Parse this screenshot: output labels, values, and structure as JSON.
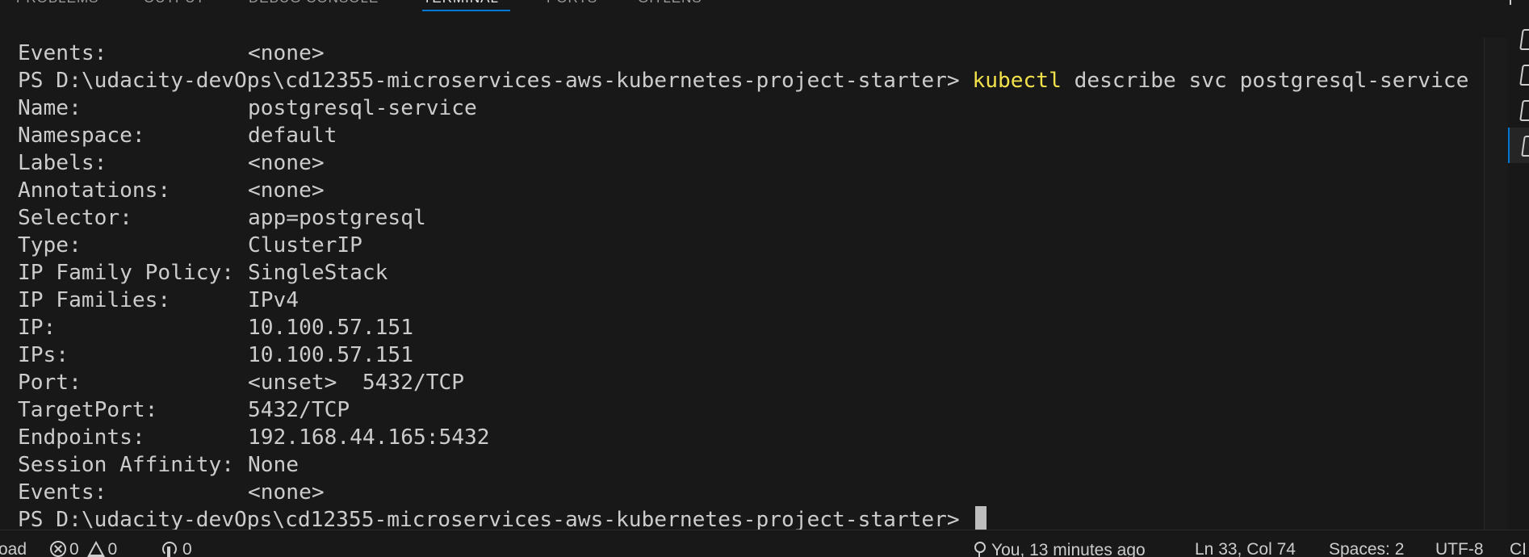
{
  "panel": {
    "tabs": [
      {
        "label": "PROBLEMS"
      },
      {
        "label": "OUTPUT"
      },
      {
        "label": "DEBUG CONSOLE"
      },
      {
        "label": "TERMINAL",
        "active": true
      },
      {
        "label": "PORTS"
      },
      {
        "label": "GITLENS"
      }
    ],
    "accent_color": "#0078d4"
  },
  "terminal": {
    "prompt": "PS D:\\udacity-devOps\\cd12355-microservices-aws-kubernetes-project-starter> ",
    "prev_events": {
      "label": "Events:",
      "value": "<none>"
    },
    "command": {
      "keyword": "kubectl",
      "args": " describe svc postgresql-service"
    },
    "fields": [
      {
        "label": "Name:",
        "value": "postgresql-service"
      },
      {
        "label": "Namespace:",
        "value": "default"
      },
      {
        "label": "Labels:",
        "value": "<none>"
      },
      {
        "label": "Annotations:",
        "value": "<none>"
      },
      {
        "label": "Selector:",
        "value": "app=postgresql"
      },
      {
        "label": "Type:",
        "value": "ClusterIP"
      },
      {
        "label": "IP Family Policy:",
        "value": "SingleStack"
      },
      {
        "label": "IP Families:",
        "value": "IPv4"
      },
      {
        "label": "IP:",
        "value": "10.100.57.151"
      },
      {
        "label": "IPs:",
        "value": "10.100.57.151"
      },
      {
        "label": "Port:",
        "value": "<unset>  5432/TCP"
      },
      {
        "label": "TargetPort:",
        "value": "5432/TCP"
      },
      {
        "label": "Endpoints:",
        "value": "192.168.44.165:5432"
      },
      {
        "label": "Session Affinity:",
        "value": "None"
      },
      {
        "label": "Events:",
        "value": "<none>"
      }
    ],
    "command_color": "#f1e14b",
    "text_color": "#cccccc",
    "background": "#181818"
  },
  "statusbar": {
    "left_cut": "oad",
    "errors": "0",
    "warnings": "0",
    "ports": "0",
    "blame": "You, 13 minutes ago",
    "position": "Ln 33, Col 74",
    "spaces": "Spaces: 2",
    "encoding": "UTF-8",
    "eol_cut": "CI"
  }
}
